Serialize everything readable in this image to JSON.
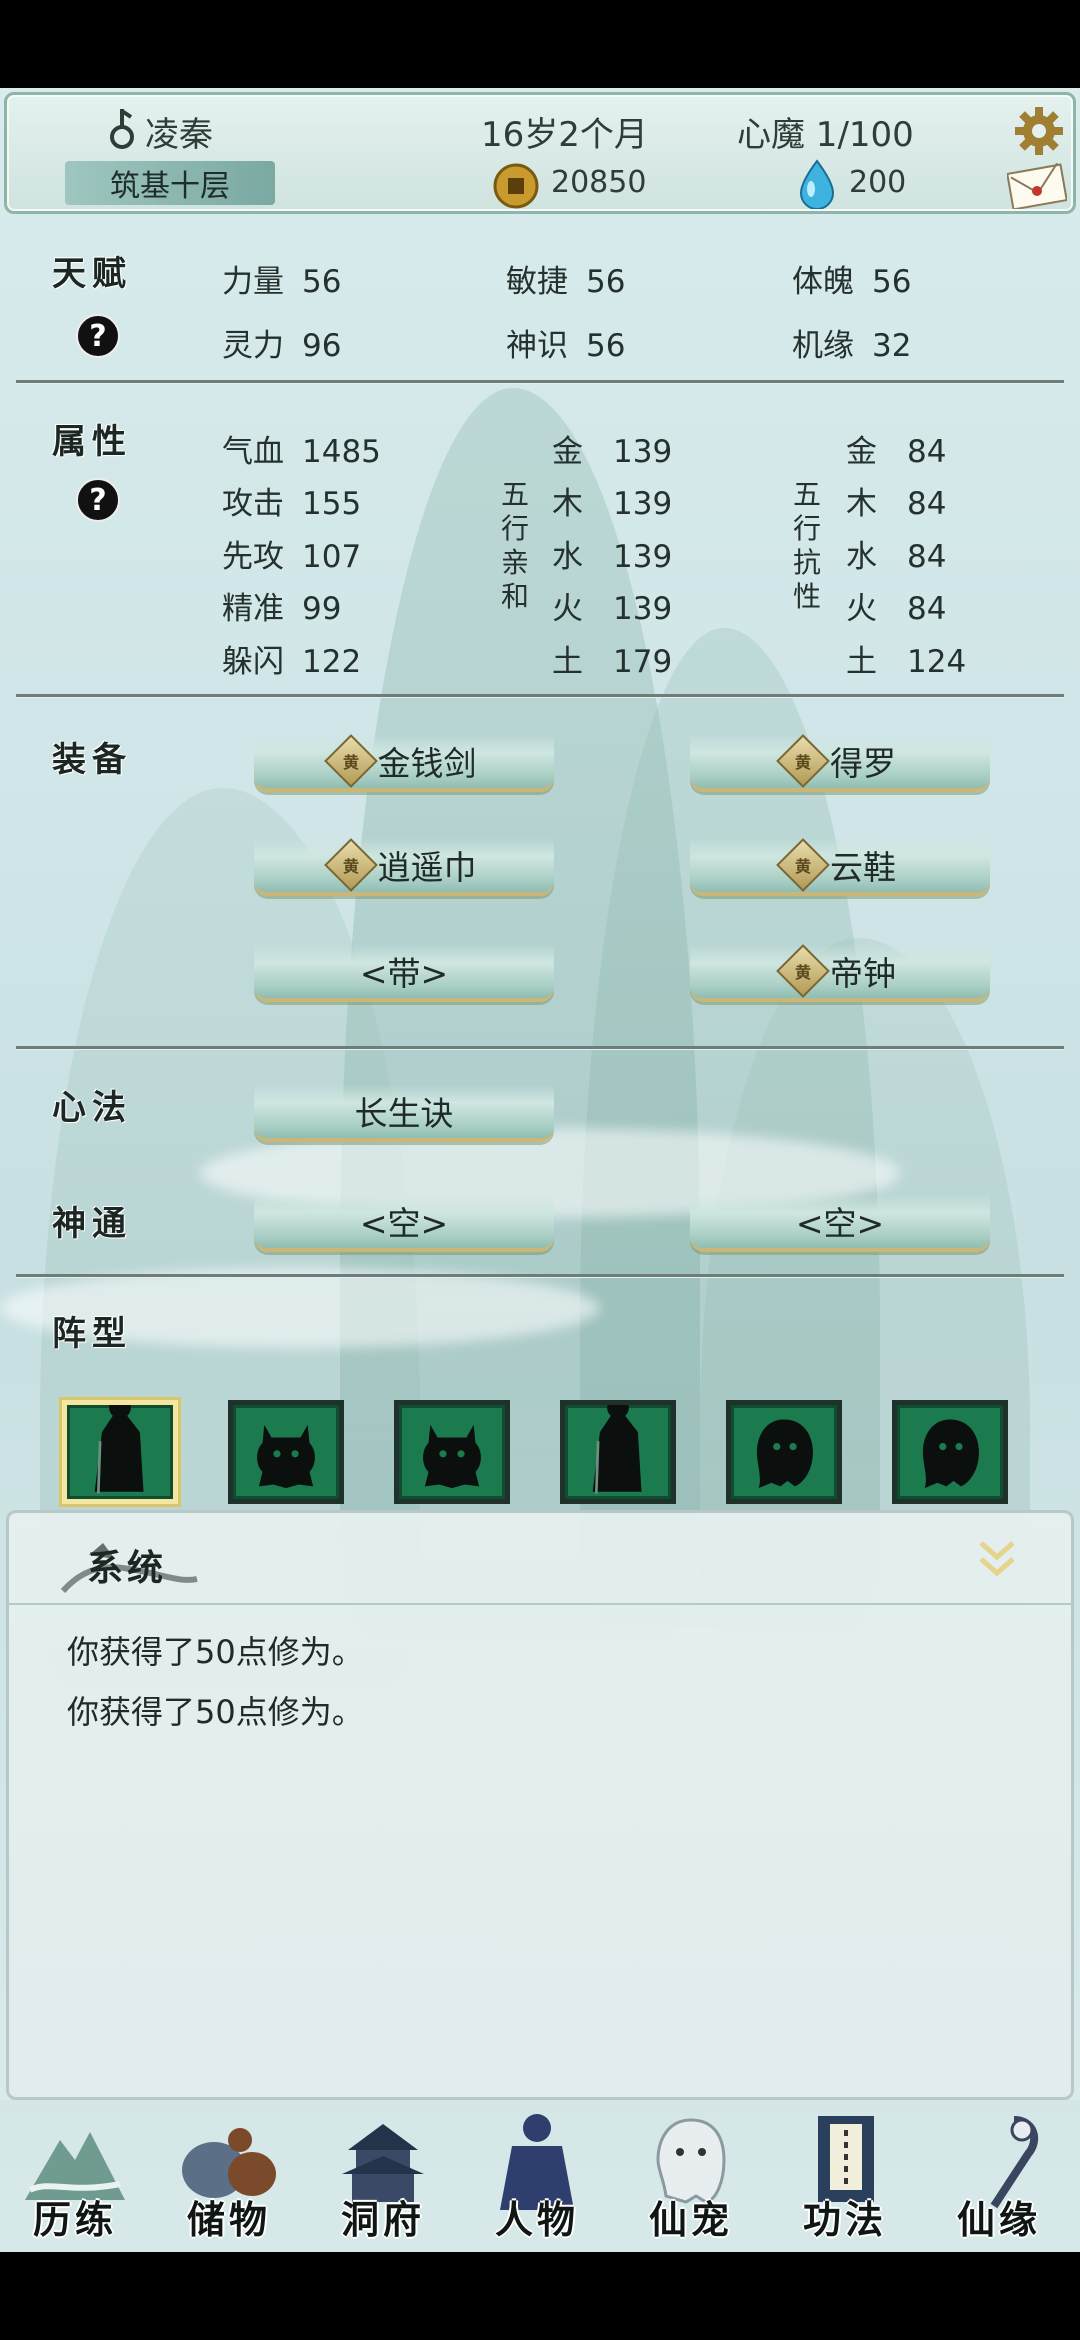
{
  "header": {
    "name": "凌秦",
    "age": "16岁2个月",
    "heart_demon": "心魔  1/100",
    "realm": "筑基十层",
    "coins": "20850",
    "spirit_stones": "200"
  },
  "talent": {
    "title": "天赋",
    "help": "?",
    "stats": [
      {
        "label": "力量",
        "value": "56"
      },
      {
        "label": "敏捷",
        "value": "56"
      },
      {
        "label": "体魄",
        "value": "56"
      },
      {
        "label": "灵力",
        "value": "96"
      },
      {
        "label": "神识",
        "value": "56"
      },
      {
        "label": "机缘",
        "value": "32"
      }
    ]
  },
  "attributes": {
    "title": "属性",
    "help": "?",
    "basic": [
      {
        "label": "气血",
        "value": "1485"
      },
      {
        "label": "攻击",
        "value": "155"
      },
      {
        "label": "先攻",
        "value": "107"
      },
      {
        "label": "精准",
        "value": "99"
      },
      {
        "label": "躲闪",
        "value": "122"
      }
    ],
    "affinity_label": [
      "五",
      "行",
      "亲",
      "和"
    ],
    "affinity": [
      {
        "element": "金",
        "value": "139"
      },
      {
        "element": "木",
        "value": "139"
      },
      {
        "element": "水",
        "value": "139"
      },
      {
        "element": "火",
        "value": "139"
      },
      {
        "element": "土",
        "value": "179"
      }
    ],
    "resist_label": [
      "五",
      "行",
      "抗",
      "性"
    ],
    "resist": [
      {
        "element": "金",
        "value": "84"
      },
      {
        "element": "木",
        "value": "84"
      },
      {
        "element": "水",
        "value": "84"
      },
      {
        "element": "火",
        "value": "84"
      },
      {
        "element": "土",
        "value": "124"
      }
    ]
  },
  "equipment": {
    "title": "装备",
    "grade_badge": "黄",
    "items": [
      "金钱剑",
      "得罗",
      "逍遥巾",
      "云鞋",
      "<带>",
      "帝钟"
    ]
  },
  "method": {
    "title": "心法",
    "item": "长生诀"
  },
  "powers": {
    "title": "神通",
    "items": [
      "<空>",
      "<空>"
    ]
  },
  "formation": {
    "title": "阵型",
    "slots": [
      "cloaked-figure",
      "horned-beast",
      "horned-beast",
      "cloaked-figure",
      "ghost",
      "ghost"
    ],
    "selected_index": 0
  },
  "system": {
    "title": "系统",
    "messages": [
      "你获得了50点修为。",
      "你获得了50点修为。"
    ]
  },
  "nav": {
    "items": [
      "历练",
      "储物",
      "洞府",
      "人物",
      "仙宠",
      "功法",
      "仙缘"
    ],
    "active": "人物"
  },
  "colors": {
    "panel_border": "#8eb5a8",
    "button_green": "#a7cdc3",
    "slot_green": "#1b7a4e",
    "gold_trim": "#c9b77a"
  }
}
